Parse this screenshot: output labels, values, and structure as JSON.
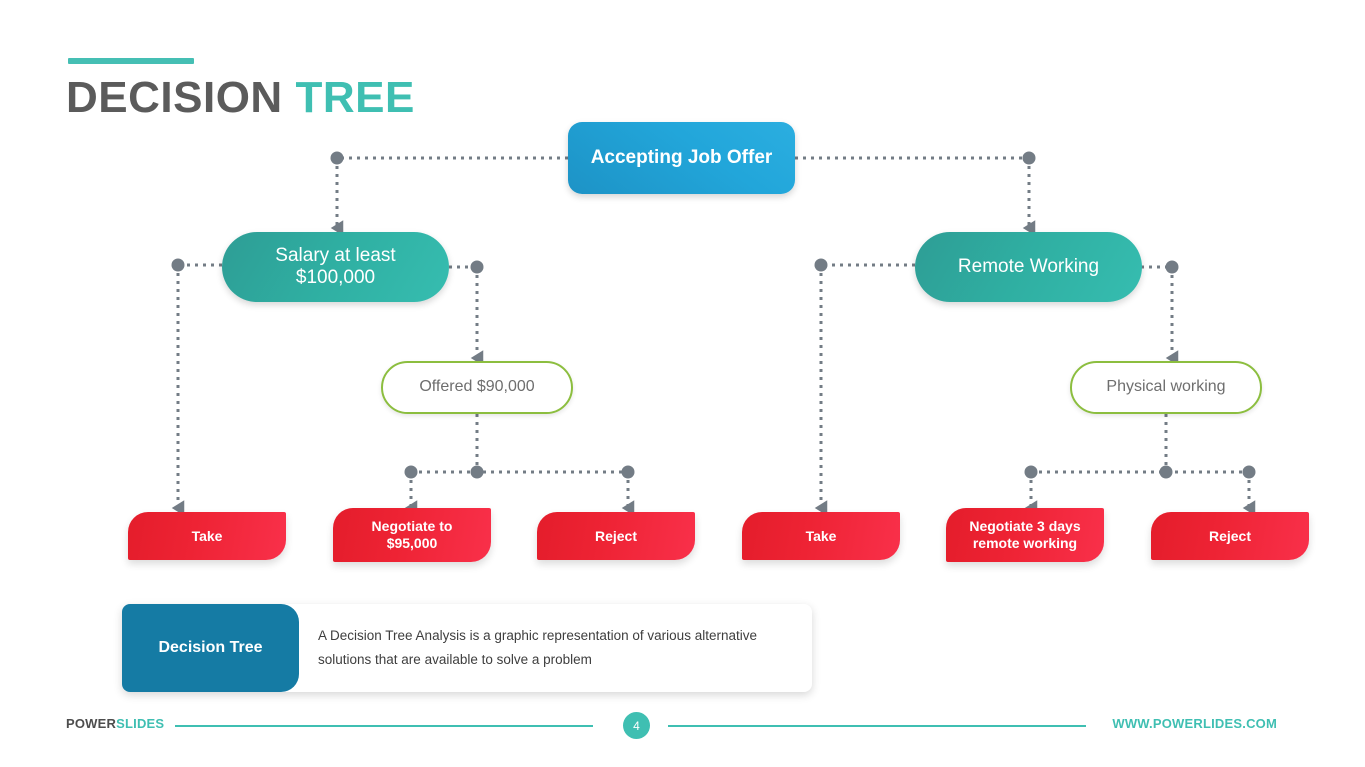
{
  "slide": {
    "title_part1": "DECISION",
    "title_part2": "TREE"
  },
  "colors": {
    "accent_teal": "#3FBFB2",
    "root_blue": "#22A6DA",
    "branch_teal": "#2FAFA2",
    "outline_green": "#8CBE3F",
    "leaf_red": "#EE2334",
    "tag_blue": "#157BA4",
    "connector_gray": "#737C85",
    "title_dark": "#5B5B5B"
  },
  "tree": {
    "root": {
      "label": "Accepting Job Offer"
    },
    "branches": [
      {
        "label": "Salary at least\n$100,000"
      },
      {
        "label": "Remote Working"
      }
    ],
    "conditions": [
      {
        "label": "Offered $90,000"
      },
      {
        "label": "Physical working"
      }
    ],
    "leaves": [
      {
        "label": "Take"
      },
      {
        "label": "Negotiate to\n$95,000"
      },
      {
        "label": "Reject"
      },
      {
        "label": "Take"
      },
      {
        "label": "Negotiate 3 days\nremote working"
      },
      {
        "label": "Reject"
      }
    ]
  },
  "description": {
    "tag": "Decision Tree",
    "text": "A Decision Tree Analysis is a graphic representation of various alternative solutions that are available to solve a problem"
  },
  "footer": {
    "logo_part1": "POWER",
    "logo_part2": "SLIDES",
    "page_number": "4",
    "url": "WWW.POWERLIDES.COM"
  }
}
